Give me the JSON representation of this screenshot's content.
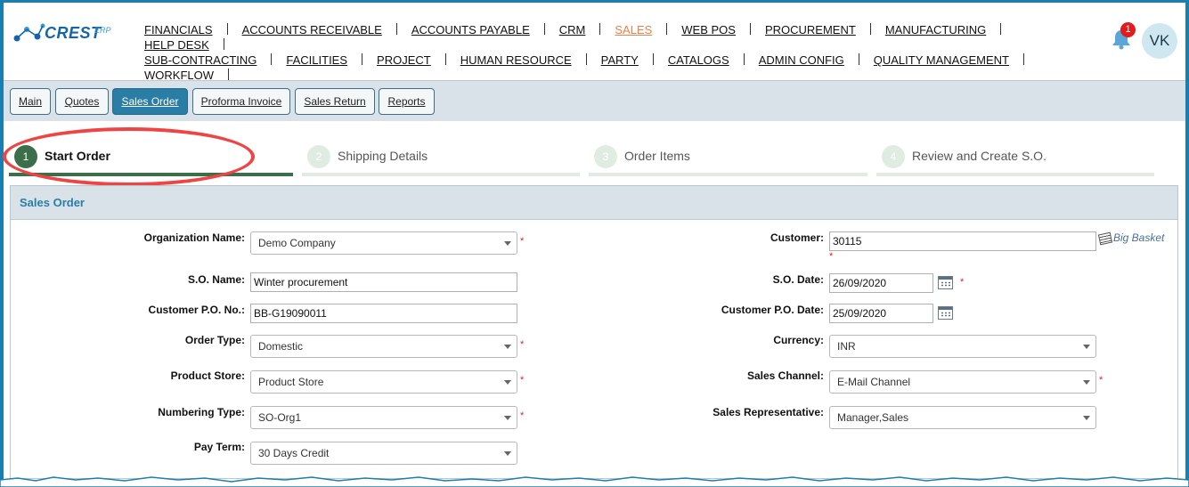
{
  "header": {
    "logo_text": "CREST",
    "logo_suffix": "ERP",
    "nav": [
      "FINANCIALS",
      "ACCOUNTS RECEIVABLE",
      "ACCOUNTS PAYABLE",
      "CRM",
      "SALES",
      "WEB POS",
      "PROCUREMENT",
      "MANUFACTURING",
      "HELP DESK",
      "SUB-CONTRACTING",
      "FACILITIES",
      "PROJECT",
      "HUMAN RESOURCE",
      "PARTY",
      "CATALOGS",
      "ADMIN CONFIG",
      "QUALITY MANAGEMENT",
      "WORKFLOW"
    ],
    "active_nav": "SALES",
    "notification_count": "1",
    "avatar_initials": "VK"
  },
  "tabs": {
    "main": "Main",
    "quotes": "Quotes",
    "sales_order": "Sales Order",
    "proforma_invoice": "Proforma Invoice",
    "sales_return": "Sales Return",
    "reports": "Reports"
  },
  "steps": {
    "s1": {
      "num": "1",
      "label": "Start Order"
    },
    "s2": {
      "num": "2",
      "label": "Shipping Details"
    },
    "s3": {
      "num": "3",
      "label": "Order Items"
    },
    "s4": {
      "num": "4",
      "label": "Review and Create S.O."
    }
  },
  "panel": {
    "title": "Sales Order"
  },
  "form": {
    "org_name_label": "Organization Name:",
    "org_name_value": "Demo Company",
    "so_name_label": "S.O. Name:",
    "so_name_value": "Winter procurement",
    "cust_po_no_label": "Customer P.O. No.:",
    "cust_po_no_value": "BB-G19090011",
    "order_type_label": "Order Type:",
    "order_type_value": "Domestic",
    "product_store_label": "Product Store:",
    "product_store_value": "Product Store",
    "numbering_type_label": "Numbering Type:",
    "numbering_type_value": "SO-Org1",
    "pay_term_label": "Pay Term:",
    "pay_term_value": "30 Days Credit",
    "customer_label": "Customer:",
    "customer_value": "30115",
    "customer_link": "Big Basket",
    "so_date_label": "S.O. Date:",
    "so_date_value": "26/09/2020",
    "cust_po_date_label": "Customer P.O. Date:",
    "cust_po_date_value": "25/09/2020",
    "currency_label": "Currency:",
    "currency_value": "INR",
    "sales_channel_label": "Sales Channel:",
    "sales_channel_value": "E-Mail Channel",
    "sales_rep_label": "Sales Representative:",
    "sales_rep_value": "Manager,Sales",
    "required_mark": "*"
  },
  "colors": {
    "brand_blue": "#1a7fb0",
    "active_tab": "#2a7ea6",
    "step_active": "#3c6e4a",
    "nav_active": "#e8824a",
    "highlight": "#ee4444"
  }
}
